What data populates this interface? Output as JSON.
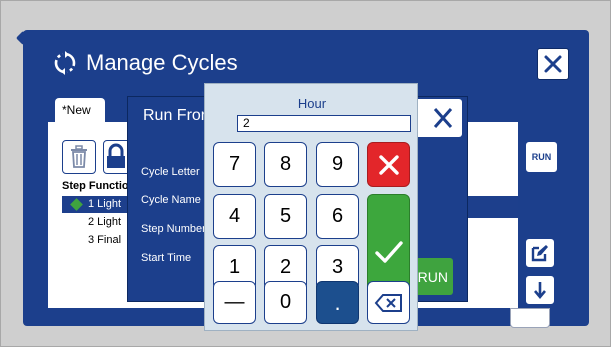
{
  "window": {
    "title": "Manage Cycles"
  },
  "tabs": {
    "new_label": "*New"
  },
  "table": {
    "header": "Step Function",
    "rows": [
      {
        "label": "1 Light"
      },
      {
        "label": "2 Light"
      },
      {
        "label": "3 Final"
      }
    ]
  },
  "side_buttons": {
    "run_label": "RUN"
  },
  "dialog": {
    "title": "Run From",
    "labels": {
      "cycle_letter": "Cycle Letter",
      "cycle_name": "Cycle Name",
      "step_number": "Step Number",
      "start_time": "Start Time"
    },
    "run_label": "RUN"
  },
  "keypad": {
    "title": "Hour",
    "value": "2",
    "keys": {
      "k7": "7",
      "k8": "8",
      "k9": "9",
      "k4": "4",
      "k5": "5",
      "k6": "6",
      "k1": "1",
      "k2": "2",
      "k3": "3",
      "minus": "—",
      "k0": "0",
      "dot": "."
    }
  },
  "colors": {
    "window_blue": "#1c3f8c",
    "clear_red": "#e3262a",
    "enter_green": "#3da73d",
    "keypad_bg": "#d7e3ed"
  },
  "icons": [
    "refresh-icon",
    "close-icon",
    "trash-icon",
    "lock-icon",
    "edit-icon",
    "arrow-down-icon",
    "check-icon",
    "backspace-icon"
  ]
}
